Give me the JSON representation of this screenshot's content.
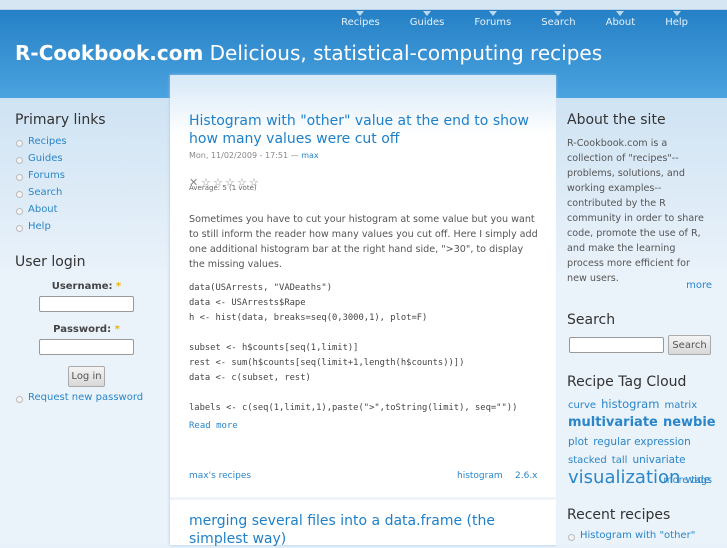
{
  "nav": [
    "Recipes",
    "Guides",
    "Forums",
    "Search",
    "About",
    "Help"
  ],
  "site": {
    "name": "R-Cookbook.com",
    "slogan": "Delicious, statistical-computing recipes"
  },
  "primary": {
    "title": "Primary links",
    "items": [
      "Recipes",
      "Guides",
      "Forums",
      "Search",
      "About",
      "Help"
    ]
  },
  "login": {
    "title": "User login",
    "username": "Username:",
    "password": "Password:",
    "required": "*",
    "button": "Log in",
    "request": "Request new password",
    "username_value": "",
    "password_value": ""
  },
  "post1": {
    "title": "Histogram with \"other\" value at the end to show how many values were cut off",
    "date": "Mon, 11/02/2009 - 17:51 —",
    "author": "max",
    "rating": 5,
    "rating_max": 5,
    "average": "Average: 5 (1 vote)",
    "body": "Sometimes you have to cut your histogram at some value but you want to still inform the reader how many values you cut off. Here I simply add one additional histogram bar at the right hand side, \">30\", to display the missing values.",
    "code": "data(USArrests, \"VADeaths\")\ndata <- USArrests$Rape\nh <- hist(data, breaks=seq(0,3000,1), plot=F)\n\nsubset <- h$counts[seq(1,limit)]\nrest <- sum(h$counts[seq(limit+1,length(h$counts))])\ndata <- c(subset, rest)\n\nlabels <- c(seq(1,limit,1),paste(\">\",toString(limit), seq=\"\"))",
    "read_more": "Read more",
    "user_recipes": "max's recipes",
    "tag1": "histogram",
    "tag2": "2.6.x"
  },
  "post2": {
    "title": "merging several files into a data.frame (the simplest way)"
  },
  "about": {
    "title": "About the site",
    "text": "R-Cookbook.com is a collection of \"recipes\"--problems, solutions, and working examples--contributed by the R community in order to share code, promote the use of R, and make the learning process more efficient for new users.",
    "more": "more"
  },
  "search": {
    "title": "Search",
    "button": "Search",
    "value": ""
  },
  "tagcloud": {
    "title": "Recipe Tag Cloud",
    "tags": [
      "curve",
      "histogram",
      "matrix",
      "multivariate",
      "newbie",
      "plot",
      "regular expression",
      "stacked",
      "tall",
      "univariate",
      "visualization",
      "wide"
    ],
    "more": "more tags"
  },
  "recent": {
    "title": "Recent recipes",
    "items": [
      "Histogram with \"other\""
    ]
  }
}
